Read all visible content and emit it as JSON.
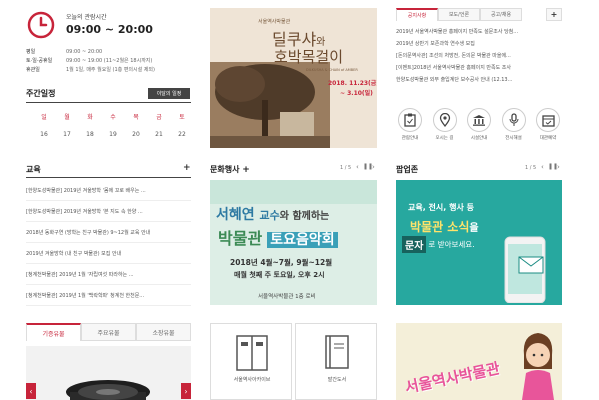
{
  "hours": {
    "label": "오늘의 관람시간",
    "time": "09:00 ~ 20:00",
    "rows": [
      {
        "k": "평일",
        "v": "09:00 ~ 20:00"
      },
      {
        "k": "토·일·공휴일",
        "v": "09:00 ~ 19:00 (11~2월은 18시까지)"
      },
      {
        "k": "휴관일",
        "v": "1월 1일, 매주 월요일 (1층 편의시설 제외)"
      }
    ]
  },
  "schedule": {
    "title": "주간일정",
    "button": "이달의 일정",
    "weekdays": [
      "일",
      "월",
      "화",
      "수",
      "목",
      "금",
      "토"
    ],
    "dates": [
      "16",
      "17",
      "18",
      "19",
      "20",
      "21",
      "22"
    ]
  },
  "banner_top": {
    "org": "서울역사박물관",
    "title1": "딜쿠샤",
    "title_particle": "와",
    "title2": "호박목걸이",
    "subtitle": "DILKUSHA & CHAIN of AMBER",
    "date1": "2018. 11.23(금)",
    "date2": "~ 3.10(일)"
  },
  "notice": {
    "tabs": [
      "공지사항",
      "보도/언론",
      "공고/채용"
    ],
    "plus": "+",
    "items": [
      "2019년 서울역사박물관 홍페이지 만족도 설문조사 당첨...",
      "2019년 상반기 보존과학 연수생 모집",
      "[돈의문역사관] 조선의 처방전, 돈의문 박물관 마을에...",
      "[이벤트]2018년 서울역사박물관 홈페이지 만족도 조사",
      "한양도성박물관 외부 출입계단 보수공사 안내 (12.13..."
    ],
    "quick": [
      {
        "icon": "clipboard-icon",
        "label": "관람안내"
      },
      {
        "icon": "map-pin-icon",
        "label": "오시는 길"
      },
      {
        "icon": "building-icon",
        "label": "시설안내"
      },
      {
        "icon": "microphone-icon",
        "label": "전시해설"
      },
      {
        "icon": "calendar-icon",
        "label": "대관예약"
      }
    ]
  },
  "education": {
    "title": "교육",
    "plus": "+",
    "items": [
      "[한양도성박물관] 2019년 겨울방학 '몸에 꼬로 배우는 ...",
      "[한양도성박물관] 2019년 겨울방학 '본 지도 속 한양 ...",
      "2018년 동화구연 (방학는 친구 박물관) 9~12월 교육 안내",
      "2019년 겨울방학 (내 친구 박물관) 모집 안내",
      "[청계천박물관] 2019년 1월 '자립여섯 따라하는 ...",
      "[청계천박물관] 2019년 1월 '백락학파' 청계천 한천문..."
    ]
  },
  "culture": {
    "title": "문화행사",
    "plus": "+",
    "pager": "1 / 5",
    "line_a": "서혜연",
    "line_b": "교수",
    "line_c": "와 함께하는",
    "line_d": "박물관",
    "line_e": "토요음악회",
    "date_line": "2018년 4월~7월, 9월~12월",
    "sub_line": "매월 첫째 주 토요일, 오후 2시",
    "place": "서울역사박물관 1층 로비"
  },
  "popup": {
    "title": "팝업존",
    "pager": "1 / 5",
    "line1": "교육, 전시, 행사 등",
    "line2": "박물관 소식",
    "line2b": "을",
    "badge": "문자",
    "line3": "로 받아보세요."
  },
  "relics": {
    "tabs": [
      "기증유물",
      "주요유물",
      "소장유물"
    ]
  },
  "archive": {
    "items": [
      {
        "icon": "archive-cabinet-icon",
        "label": "서울역사아카이브"
      },
      {
        "icon": "book-icon",
        "label": "발간도서"
      }
    ]
  },
  "bottom_banner": {
    "text": "서울역사박물관"
  },
  "colors": {
    "accent": "#c7243a",
    "banner_blue": "#5cb9c9",
    "banner_green": "#86c4b6",
    "popup_teal": "#22a7a0",
    "sepia": "#8a6b4f"
  }
}
